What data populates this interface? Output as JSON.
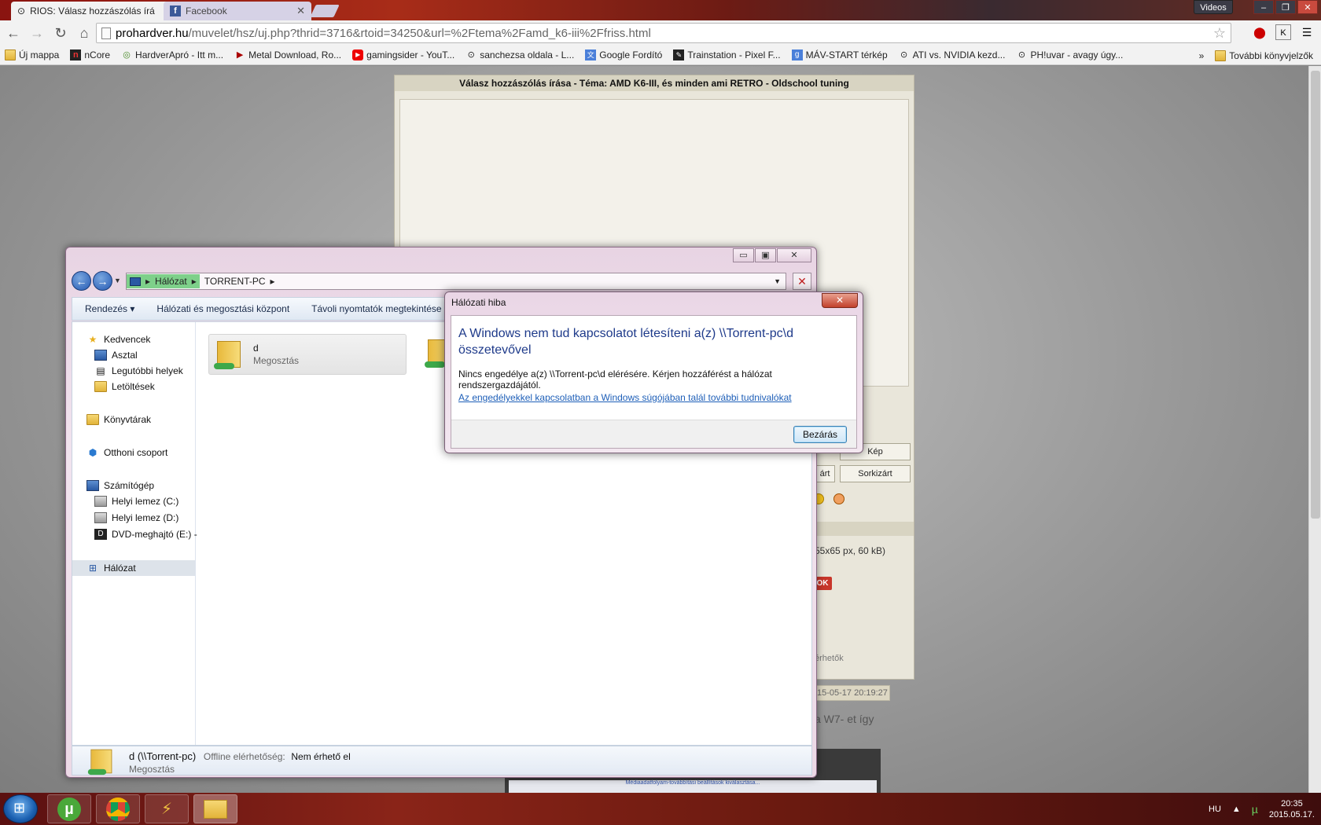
{
  "browser": {
    "tabs": [
      {
        "title": "RIOS: Válasz hozzászólás írá"
      },
      {
        "title": "Facebook"
      }
    ],
    "videos_label": "Videos",
    "url_host": "prohardver.hu",
    "url_path": "/muvelet/hsz/uj.php?thrid=3716&rtoid=34250&url=%2Ftema%2Famd_k6-iii%2Ffriss.html",
    "bookmarks": [
      {
        "label": "Új mappa"
      },
      {
        "label": "nCore"
      },
      {
        "label": "HardverApró - Itt m..."
      },
      {
        "label": "Metal Download, Ro..."
      },
      {
        "label": "gamingsider - YouT..."
      },
      {
        "label": "sanchezsa oldala - L..."
      },
      {
        "label": "Google Fordító"
      },
      {
        "label": "Trainstation - Pixel F..."
      },
      {
        "label": "MÁV-START térkép"
      },
      {
        "label": "ATI vs. NVIDIA kezd..."
      },
      {
        "label": "PH!uvar - avagy úgy..."
      }
    ],
    "bookmarks_more": "»",
    "other_bookmarks": "További könyvjelzők"
  },
  "page": {
    "reply_title": "Válasz hozzászólás írása - Téma: AMD K6-III, és minden ami RETRO - Oldschool tuning",
    "btn_kep": "Kép",
    "btn_zart": "árt",
    "btn_sorkizart": "Sorkizárt",
    "size_text": "55x65 px, 60 kB)",
    "ok_label": "OK",
    "erheto_text": "érhetők",
    "post_date": "15-05-17 20:19:27",
    "post_text": "a W7- et így",
    "mini_text": "Médiaadatfolyam-továbbítási beállítások kiválasztása..."
  },
  "explorer": {
    "breadcrumbs": [
      "Hálózat",
      "TORRENT-PC"
    ],
    "toolbar": [
      "Rendezés",
      "Hálózati és megosztási központ",
      "Távoli nyomtatók megtekintése"
    ],
    "nav": {
      "favorites": "Kedvencek",
      "desktop": "Asztal",
      "recent": "Legutóbbi helyek",
      "downloads": "Letöltések",
      "libraries": "Könyvtárak",
      "homegroup": "Otthoni csoport",
      "computer": "Számítógép",
      "drive_c": "Helyi lemez (C:)",
      "drive_d": "Helyi lemez (D:)",
      "dvd": "DVD-meghajtó (E:) -",
      "network": "Hálózat"
    },
    "share": {
      "name": "d",
      "type": "Megosztás"
    },
    "details": {
      "name": "d (\\\\Torrent-pc)",
      "offline_label": "Offline elérhetőség:",
      "offline_value": "Nem érhető el",
      "type": "Megosztás"
    }
  },
  "dialog": {
    "title": "Hálózati hiba",
    "main": "A Windows nem tud kapcsolatot létesíteni a(z) \\\\Torrent-pc\\d összetevővel",
    "message": "Nincs engedélye a(z) \\\\Torrent-pc\\d elérésére. Kérjen hozzáférést a hálózat rendszergazdájától.",
    "link": "Az engedélyekkel kapcsolatban a Windows súgójában talál további tudnivalókat",
    "close_button": "Bezárás"
  },
  "taskbar": {
    "lang": "HU",
    "time": "20:35",
    "date": "2015.05.17."
  }
}
